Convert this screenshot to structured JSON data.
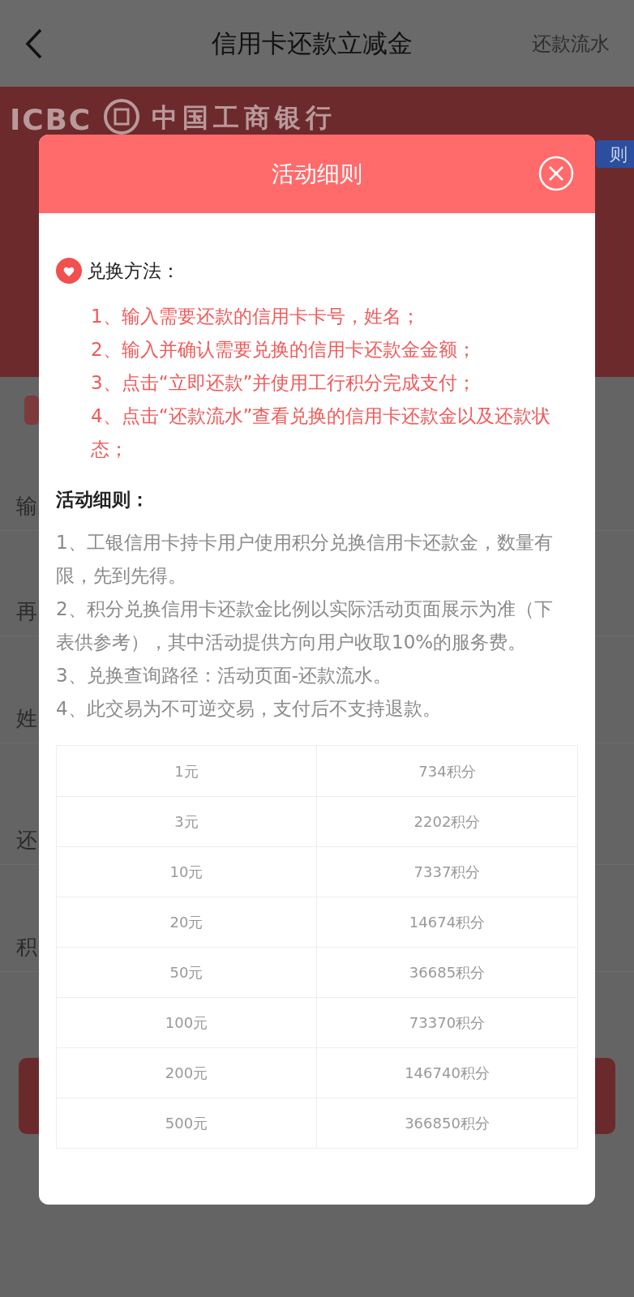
{
  "header": {
    "title": "信用卡还款立减金",
    "action": "还款流水"
  },
  "banner": {
    "logo_text": "ICBC",
    "bank_name": "中国工商银行",
    "tab": "则"
  },
  "form": {
    "labels": [
      "输",
      "再",
      "姓",
      "还",
      "积"
    ]
  },
  "dialog": {
    "title": "活动细则",
    "sections": [
      {
        "kind": "steps",
        "heading": "兑换方法：",
        "items": [
          "1、输入需要还款的信用卡卡号，姓名；",
          "2、输入并确认需要兑换的信用卡还款金金额；",
          "3、点击“立即还款”并使用工行积分完成支付；",
          "4、点击“还款流水”查看兑换的信用卡还款金以及还款状态；"
        ]
      },
      {
        "kind": "rules",
        "heading": "活动细则：",
        "items": [
          "1、工银信用卡持卡用户使用积分兑换信用卡还款金，数量有限，先到先得。",
          "2、积分兑换信用卡还款金比例以实际活动页面展示为准（下表供参考），其中活动提供方向用户收取10%的服务费。",
          "3、兑换查询路径：活动页面-还款流水。",
          "4、此交易为不可逆交易，支付后不支持退款。"
        ]
      }
    ],
    "table": {
      "rows": [
        [
          "1元",
          "734积分"
        ],
        [
          "3元",
          "2202积分"
        ],
        [
          "10元",
          "7337积分"
        ],
        [
          "20元",
          "14674积分"
        ],
        [
          "50元",
          "36685积分"
        ],
        [
          "100元",
          "73370积分"
        ],
        [
          "200元",
          "146740积分"
        ],
        [
          "500元",
          "366850积分"
        ]
      ]
    }
  }
}
